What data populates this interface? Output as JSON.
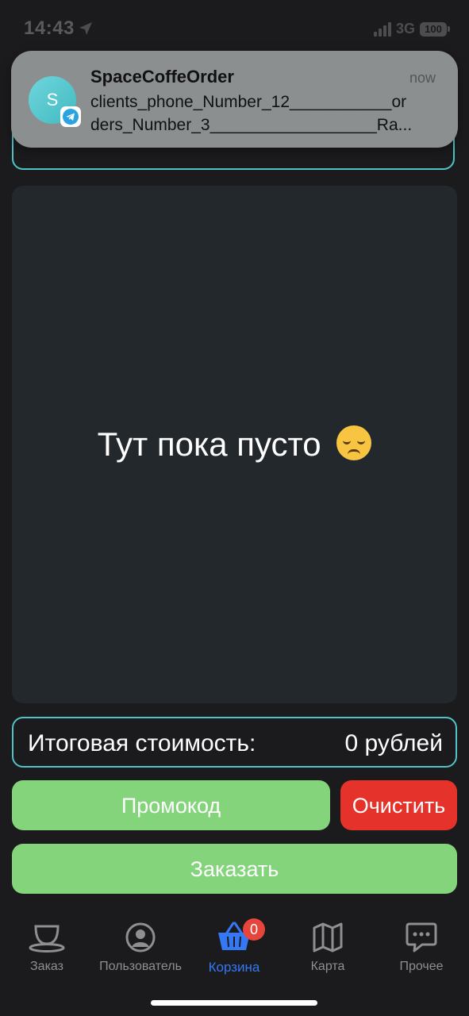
{
  "status_bar": {
    "time": "14:43",
    "network": "3G",
    "battery": "100"
  },
  "notification": {
    "avatar_letter": "S",
    "app_name": "SpaceCoffeOrder",
    "time": "now",
    "line1": "clients_phone_Number_12___________or",
    "line2": "ders_Number_3__________________Ra..."
  },
  "content": {
    "empty_message": "Тут пока пусто"
  },
  "total": {
    "label": "Итоговая стоимость:",
    "value": "0 рублей"
  },
  "buttons": {
    "promo": "Промокод",
    "clear": "Очистить",
    "order": "Заказать"
  },
  "tab_bar": {
    "tabs": [
      {
        "label": "Заказ",
        "icon": "coffee-cup-icon"
      },
      {
        "label": "Пользователь",
        "icon": "user-icon"
      },
      {
        "label": "Корзина",
        "icon": "basket-icon",
        "badge": "0",
        "active": true
      },
      {
        "label": "Карта",
        "icon": "map-icon"
      },
      {
        "label": "Прочее",
        "icon": "chat-icon"
      }
    ]
  },
  "colors": {
    "accent_outline": "#4fc3c7",
    "green_button": "#84d47c",
    "red_button": "#e5322a",
    "active_tab": "#3478f6",
    "badge": "#e5453a"
  }
}
